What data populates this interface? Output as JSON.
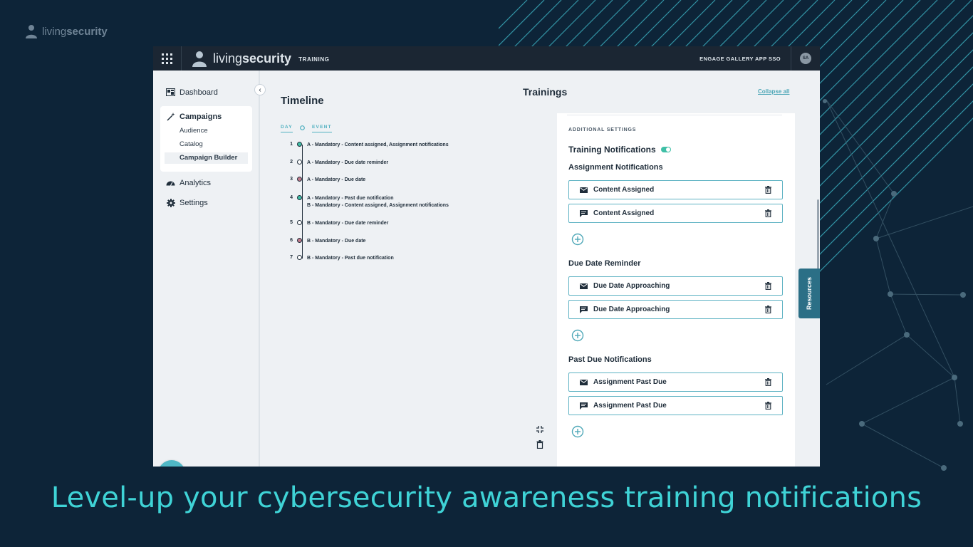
{
  "brand": {
    "light": "living",
    "bold": "security"
  },
  "app": {
    "logo_light": "living",
    "logo_bold": "security",
    "logo_sub": "TRAINING",
    "sso_label": "ENGAGE GALLERY APP SSO",
    "avatar_initials": "SA"
  },
  "sidebar": {
    "dashboard": "Dashboard",
    "campaigns": "Campaigns",
    "sub_items": [
      "Audience",
      "Catalog",
      "Campaign Builder"
    ],
    "analytics": "Analytics",
    "settings": "Settings",
    "collapse_glyph": "‹"
  },
  "timeline": {
    "title": "Timeline",
    "col_day": "DAY",
    "col_event": "EVENT",
    "rows": [
      {
        "day": "1",
        "text": "A - Mandatory - Content assigned, Assignment notifications",
        "dot": "#3fbfa6"
      },
      {
        "day": "2",
        "text": "A - Mandatory - Due date reminder",
        "dot": "#ffffff"
      },
      {
        "day": "3",
        "text": "A - Mandatory - Due date",
        "dot": "#c07a8a"
      },
      {
        "day": "4",
        "text": "A - Mandatory - Past due notification",
        "text2": "B - Mandatory - Content assigned, Assignment notifications",
        "dot": "#3fbfa6"
      },
      {
        "day": "5",
        "text": "B - Mandatory - Due date reminder",
        "dot": "#ffffff"
      },
      {
        "day": "6",
        "text": "B - Mandatory - Due date",
        "dot": "#c07a8a"
      },
      {
        "day": "7",
        "text": "B - Mandatory - Past due notification",
        "dot": "#ffffff"
      }
    ]
  },
  "trainings": {
    "title": "Trainings",
    "collapse_all": "Collapse all",
    "additional_settings": "ADDITIONAL SETTINGS",
    "training_notifications": "Training Notifications",
    "toggle_on": true,
    "sections": [
      {
        "label": "Assignment Notifications",
        "items": [
          {
            "icon": "email-icon",
            "label": "Content Assigned"
          },
          {
            "icon": "message-icon",
            "label": "Content Assigned"
          }
        ]
      },
      {
        "label": "Due Date Reminder",
        "items": [
          {
            "icon": "email-icon",
            "label": "Due Date Approaching"
          },
          {
            "icon": "message-icon",
            "label": "Due Date Approaching"
          }
        ]
      },
      {
        "label": "Past Due Notifications",
        "items": [
          {
            "icon": "email-icon",
            "label": "Assignment Past Due"
          },
          {
            "icon": "message-icon",
            "label": "Assignment Past Due"
          }
        ]
      }
    ]
  },
  "resources_tab": "Resources",
  "tagline": "Level-up your cybersecurity awareness training notifications",
  "colors": {
    "background": "#0d2438",
    "accent": "#3fd3d6",
    "topbar": "#1b2633",
    "border": "#5db2c3"
  }
}
